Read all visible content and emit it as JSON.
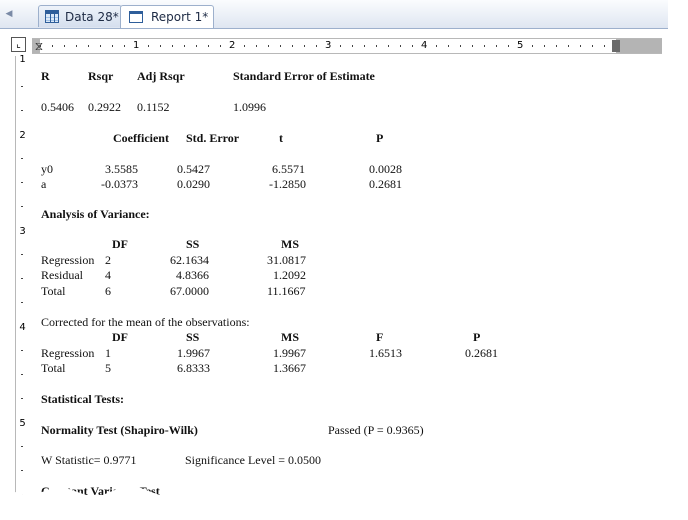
{
  "tabs": [
    {
      "label": "Data 28*",
      "icon": "worksheet-icon"
    },
    {
      "label": "Report 1*",
      "icon": "report-icon"
    }
  ],
  "ruler": {
    "h_numbers": [
      "1",
      "2",
      "3",
      "4",
      "5"
    ],
    "v_numbers": [
      "1",
      "2",
      "3",
      "4",
      "5"
    ]
  },
  "summary": {
    "headers": [
      "R",
      "Rsqr",
      "Adj Rsqr",
      "Standard Error of Estimate"
    ],
    "values": [
      "0.5406",
      "0.2922",
      "0.1152",
      "1.0996"
    ]
  },
  "coefficients": {
    "headers": [
      "Coefficient",
      "Std. Error",
      "t",
      "P"
    ],
    "rows": [
      {
        "name": "y0",
        "coef": "3.5585",
        "se": "0.5427",
        "t": "6.5571",
        "p": "0.0028"
      },
      {
        "name": "a",
        "coef": "-0.0373",
        "se": "0.0290",
        "t": "-1.2850",
        "p": "0.2681"
      }
    ]
  },
  "anova": {
    "title": "Analysis of Variance:",
    "headers": [
      "DF",
      "SS",
      "MS"
    ],
    "rows": [
      {
        "name": "Regression",
        "df": "2",
        "ss": "62.1634",
        "ms": "31.0817"
      },
      {
        "name": "Residual",
        "df": "4",
        "ss": "4.8366",
        "ms": "1.2092"
      },
      {
        "name": "Total",
        "df": "6",
        "ss": "67.0000",
        "ms": "11.1667"
      }
    ]
  },
  "corrected": {
    "note": "Corrected for the mean of the observations:",
    "headers": [
      "DF",
      "SS",
      "MS",
      "F",
      "P"
    ],
    "rows": [
      {
        "name": "Regression",
        "df": "1",
        "ss": "1.9967",
        "ms": "1.9967",
        "f": "1.6513",
        "p": "0.2681"
      },
      {
        "name": "Total",
        "df": "5",
        "ss": "6.8333",
        "ms": "1.3667",
        "f": "",
        "p": ""
      }
    ]
  },
  "tests": {
    "title": "Statistical Tests:",
    "normality_title": "Normality Test (Shapiro-Wilk)",
    "normality_result": "Passed   (P = 0.9365)",
    "w_statistic": "W Statistic= 0.9771",
    "significance": "Significance Level = 0.0500",
    "constant_variance": "Constant Variance Test"
  }
}
